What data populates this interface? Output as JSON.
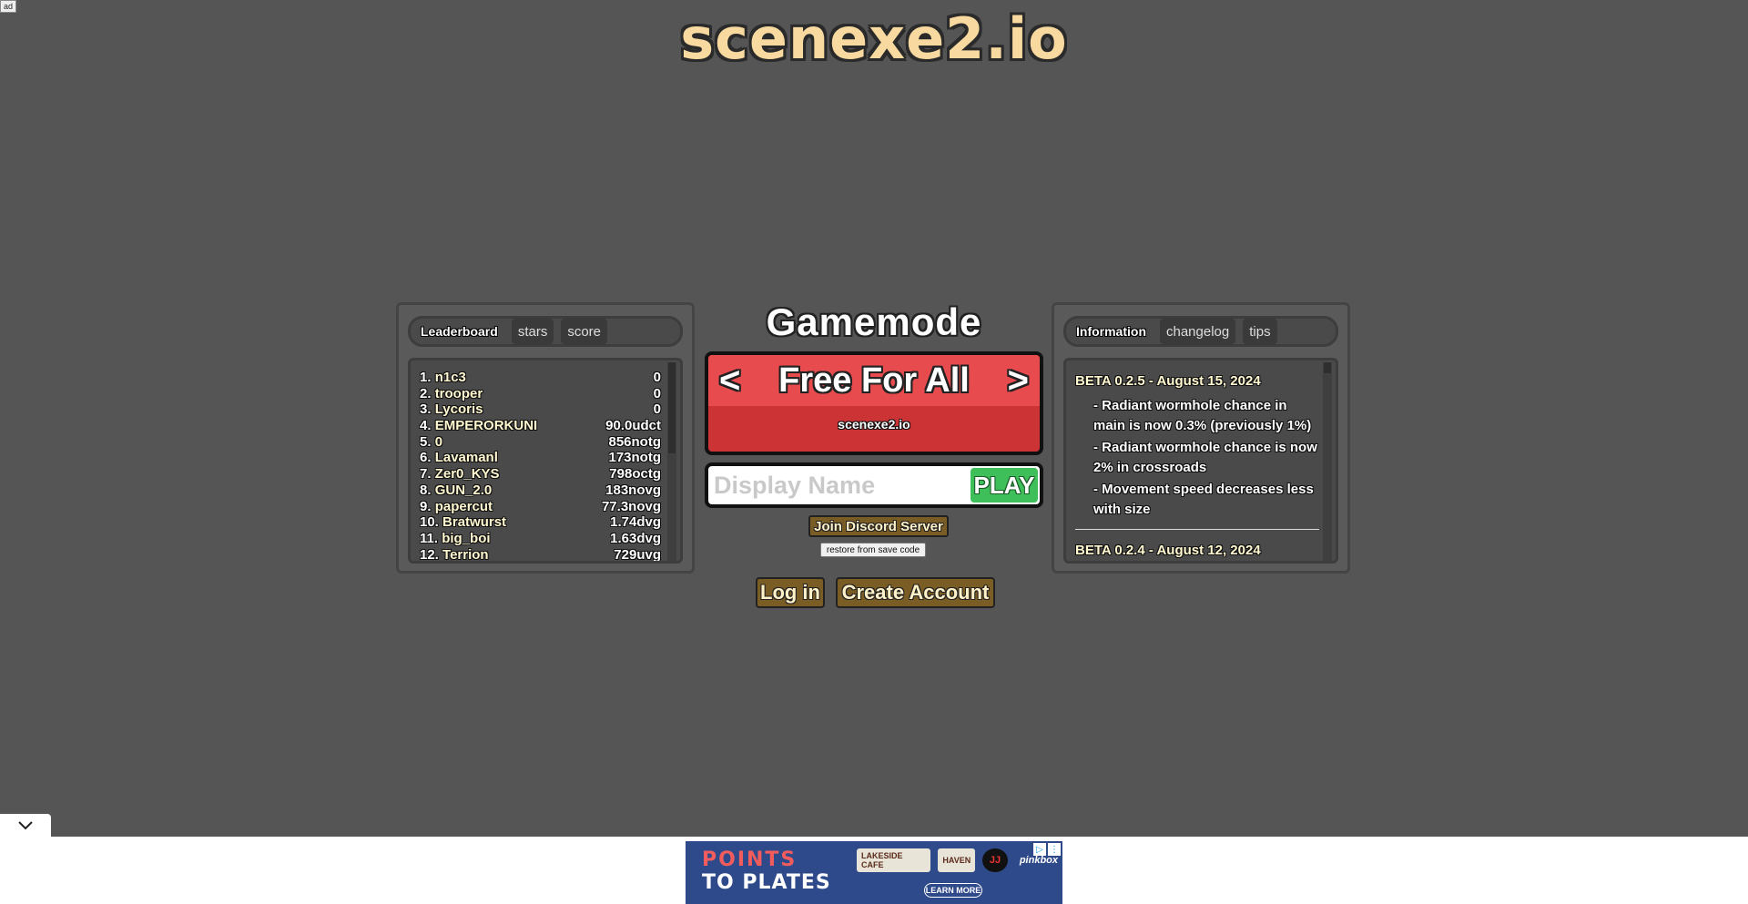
{
  "ad_label": "ad",
  "logo": "scenexe2.io",
  "leaderboard": {
    "tabs": [
      {
        "label": "Leaderboard"
      },
      {
        "label": "stars"
      },
      {
        "label": "score"
      }
    ],
    "rows": [
      {
        "rank": "1.",
        "name": "n1c3",
        "score": "0"
      },
      {
        "rank": "2.",
        "name": "trooper",
        "score": "0"
      },
      {
        "rank": "3.",
        "name": "Lycoris",
        "score": "0"
      },
      {
        "rank": "4.",
        "name": "EMPERORKUNI",
        "score": "90.0udct"
      },
      {
        "rank": "5.",
        "name": "0",
        "score": "856notg"
      },
      {
        "rank": "6.",
        "name": "Lavamanl",
        "score": "173notg"
      },
      {
        "rank": "7.",
        "name": "Zer0_KYS",
        "score": "798octg"
      },
      {
        "rank": "8.",
        "name": "GUN_2.0",
        "score": "183novg"
      },
      {
        "rank": "9.",
        "name": "papercut",
        "score": "77.3novg"
      },
      {
        "rank": "10.",
        "name": "Bratwurst",
        "score": "1.74dvg"
      },
      {
        "rank": "11.",
        "name": "big_boi",
        "score": "1.63dvg"
      },
      {
        "rank": "12.",
        "name": "Terrion",
        "score": "729uvg"
      }
    ]
  },
  "gamemode": {
    "title": "Gamemode",
    "prev": "<",
    "next": ">",
    "name": "Free For All",
    "server": "scenexe2.io"
  },
  "display_name": {
    "placeholder": "Display Name",
    "value": ""
  },
  "play_label": "PLAY",
  "discord_label": "Join Discord Server",
  "restore_label": "restore from save code",
  "login_label": "Log in",
  "create_account_label": "Create Account",
  "info": {
    "tabs": [
      {
        "label": "Information"
      },
      {
        "label": "changelog"
      },
      {
        "label": "tips"
      }
    ],
    "entries": [
      {
        "heading": "BETA 0.2.5 - August 15, 2024",
        "items": [
          "- Radiant wormhole chance in main is now 0.3% (previously 1%)",
          "- Radiant wormhole chance is now 2% in crossroads",
          "- Movement speed decreases less with size"
        ]
      },
      {
        "heading": "BETA 0.2.4 - August 12, 2024",
        "items": []
      }
    ]
  },
  "ad_banner": {
    "line1": "POINTS",
    "line2": "TO PLATES",
    "logos": [
      "LAKESIDE CAFE",
      "HAVEN",
      "JJ",
      "pinkbox"
    ],
    "cta": "LEARN MORE"
  }
}
